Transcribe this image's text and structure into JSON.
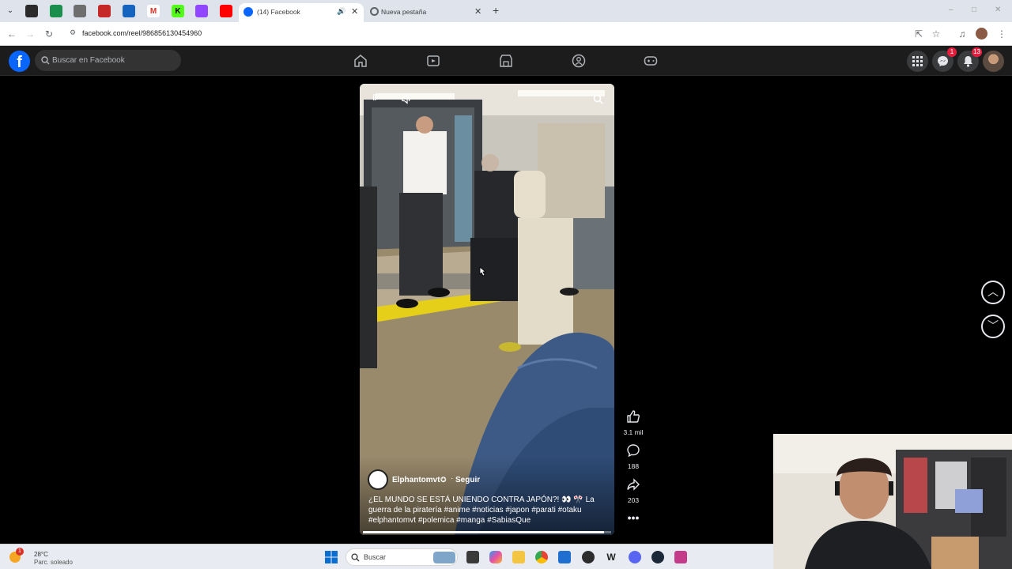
{
  "browser": {
    "tabs": [
      {
        "title": "(14) Facebook",
        "active": true
      },
      {
        "title": "Nueva pestaña",
        "active": false
      }
    ],
    "url": "facebook.com/reel/986856130454960"
  },
  "facebook": {
    "logo_text": "f",
    "search_placeholder": "Buscar en Facebook",
    "messenger_badge": "1",
    "notifications_badge": "13"
  },
  "reel": {
    "author": "Elphantomvt",
    "follow_label": "Seguir",
    "caption": "¿EL MUNDO SE ESTÁ UNIENDO CONTRA JAPÓN?! 👀 🎌 La guerra de la piratería #anime #noticias #japon #parati #otaku #elphantomvt #polemica  #manga #SabiasQue",
    "progress": 0.97,
    "likes": "3.1 mil",
    "comments": "188",
    "shares": "203"
  },
  "taskbar": {
    "temperature": "28°C",
    "weather": "Parc. soleado",
    "search_placeholder": "Buscar",
    "weather_badge": "1"
  },
  "colors": {
    "facebook_blue": "#0866ff",
    "fb_bar": "#1c1c1d",
    "badge_red": "#e41e3f"
  }
}
